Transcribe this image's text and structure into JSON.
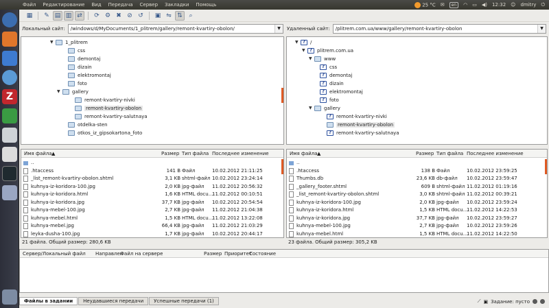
{
  "topbar": {
    "menu": [
      "Файл",
      "Редактирование",
      "Вид",
      "Передача",
      "Сервер",
      "Закладки",
      "Помощь"
    ],
    "temperature": "25 °C",
    "keyboard": "en",
    "time": "12:32",
    "user": "dmitry"
  },
  "local": {
    "site_label": "Локальный сайт:",
    "site_path": "/windows/d/MyDocuments/1_plitrem/gallery/remont-kvartiry-obolon/",
    "tree": [
      "1_plitrem",
      "css",
      "demontaj",
      "dizain",
      "elektromontaj",
      "foto",
      "gallery",
      "remont-kvartiry-nivki",
      "remont-kvartiry-obolon",
      "remont-kvartiry-salutnaya",
      "otdelka-sten",
      "otkos_iz_gipsokartona_foto"
    ],
    "headers": {
      "name": "Имя файла",
      "size": "Размер",
      "type": "Тип файла",
      "modified": "Последнее изменение"
    },
    "files": [
      {
        "name": "..",
        "size": "",
        "type": "",
        "modified": ""
      },
      {
        "name": ".htaccess",
        "size": "141 B",
        "type": "Файл",
        "modified": "10.02.2012 21:11:25"
      },
      {
        "name": "_list_remont-kvartiry-obolon.shtml",
        "size": "3,1 KB",
        "type": "shtml-файл",
        "modified": "10.02.2012 23:24:14"
      },
      {
        "name": "kuhnya-iz-koridora-100.jpg",
        "size": "2,0 KB",
        "type": "jpg-файл",
        "modified": "11.02.2012 20:56:32"
      },
      {
        "name": "kuhnya-iz-koridora.html",
        "size": "1,6 KB",
        "type": "HTML docu...",
        "modified": "11.02.2012 00:10:51"
      },
      {
        "name": "kuhnya-iz-koridora.jpg",
        "size": "37,7 KB",
        "type": "jpg-файл",
        "modified": "10.02.2012 20:54:54"
      },
      {
        "name": "kuhnya-mebel-100.jpg",
        "size": "2,7 KB",
        "type": "jpg-файл",
        "modified": "11.02.2012 21:04:38"
      },
      {
        "name": "kuhnya-mebel.html",
        "size": "1,5 KB",
        "type": "HTML docu...",
        "modified": "11.02.2012 13:22:08"
      },
      {
        "name": "kuhnya-mebel.jpg",
        "size": "66,4 KB",
        "type": "jpg-файл",
        "modified": "11.02.2012 21:03:29"
      },
      {
        "name": "leyka-dusha-100.jpg",
        "size": "1,7 KB",
        "type": "jpg-файл",
        "modified": "10.02.2012 20:44:17"
      }
    ],
    "status": "21 файла. Общий размер: 280,6 KB"
  },
  "remote": {
    "site_label": "Удаленный сайт:",
    "site_path": "/plitrem.com.ua/www/gallery/remont-kvartiry-obolon",
    "tree": [
      "/",
      "plitrem.com.ua",
      "www",
      "css",
      "demontaj",
      "dizain",
      "elektromontaj",
      "foto",
      "gallery",
      "remont-kvartiry-nivki",
      "remont-kvartiry-obolon",
      "remont-kvartiry-salutnaya"
    ],
    "headers": {
      "name": "Имя файла",
      "size": "Размер",
      "type": "Тип файла",
      "modified": "Последнее изменение"
    },
    "files": [
      {
        "name": "..",
        "size": "",
        "type": "",
        "modified": ""
      },
      {
        "name": ".htaccess",
        "size": "138 B",
        "type": "Файл",
        "modified": "10.02.2012 23:59:25"
      },
      {
        "name": "Thumbs.db",
        "size": "23,6 KB",
        "type": "db-файл",
        "modified": "10.02.2012 23:59:47"
      },
      {
        "name": "_gallery_footer.shtml",
        "size": "609 B",
        "type": "shtml-файл",
        "modified": "11.02.2012 01:19:16"
      },
      {
        "name": "_list_remont-kvartiry-obolon.shtml",
        "size": "3,0 KB",
        "type": "shtml-файл",
        "modified": "11.02.2012 00:39:21"
      },
      {
        "name": "kuhnya-iz-koridora-100.jpg",
        "size": "2,0 KB",
        "type": "jpg-файл",
        "modified": "10.02.2012 23:59:24"
      },
      {
        "name": "kuhnya-iz-koridora.html",
        "size": "1,5 KB",
        "type": "HTML docu...",
        "modified": "11.02.2012 14:22:53"
      },
      {
        "name": "kuhnya-iz-koridora.jpg",
        "size": "37,7 KB",
        "type": "jpg-файл",
        "modified": "10.02.2012 23:59:27"
      },
      {
        "name": "kuhnya-mebel-100.jpg",
        "size": "2,7 KB",
        "type": "jpg-файл",
        "modified": "10.02.2012 23:59:26"
      },
      {
        "name": "kuhnya-mebel.html",
        "size": "1,5 KB",
        "type": "HTML docu...",
        "modified": "11.02.2012 14:22:50"
      }
    ],
    "status": "23 файла. Общий размер: 305,2 KB"
  },
  "queue": {
    "headers": [
      "Сервер/Локальный файл",
      "Направлен",
      "Файл на сервере",
      "Размер",
      "Приоритет",
      "Состояние"
    ]
  },
  "tabs": [
    "Файлы в задании",
    "Неудавшиеся передачи",
    "Успешные передачи (1)"
  ],
  "bottom": {
    "queue_label": "Задание: пусто"
  }
}
